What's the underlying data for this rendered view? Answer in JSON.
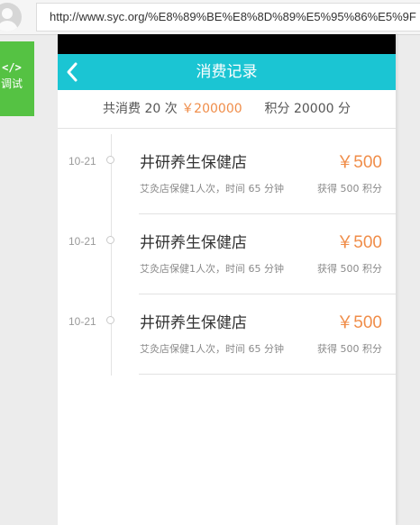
{
  "browser": {
    "url": "http://www.syc.org/%E8%89%BE%E8%8D%89%E5%95%86%E5%9F"
  },
  "debug": {
    "code_glyph": "</>",
    "label": "调试"
  },
  "header": {
    "title": "消费记录",
    "color": "#1bc5d3"
  },
  "summary": {
    "count_label": "共消费 20 次",
    "total": "￥200000",
    "points_label": "积分 20000 分"
  },
  "records": [
    {
      "date": "10-21",
      "shop": "井研养生保健店",
      "amount": "￥500",
      "desc": "艾灸店保健1人次，时间 65 分钟",
      "points": "获得 500 积分"
    },
    {
      "date": "10-21",
      "shop": "井研养生保健店",
      "amount": "￥500",
      "desc": "艾灸店保健1人次，时间 65 分钟",
      "points": "获得 500 积分"
    },
    {
      "date": "10-21",
      "shop": "井研养生保健店",
      "amount": "￥500",
      "desc": "艾灸店保健1人次，时间 65 分钟",
      "points": "获得 500 积分"
    }
  ],
  "colors": {
    "accent": "#f08d49",
    "debug_green": "#55c243"
  }
}
